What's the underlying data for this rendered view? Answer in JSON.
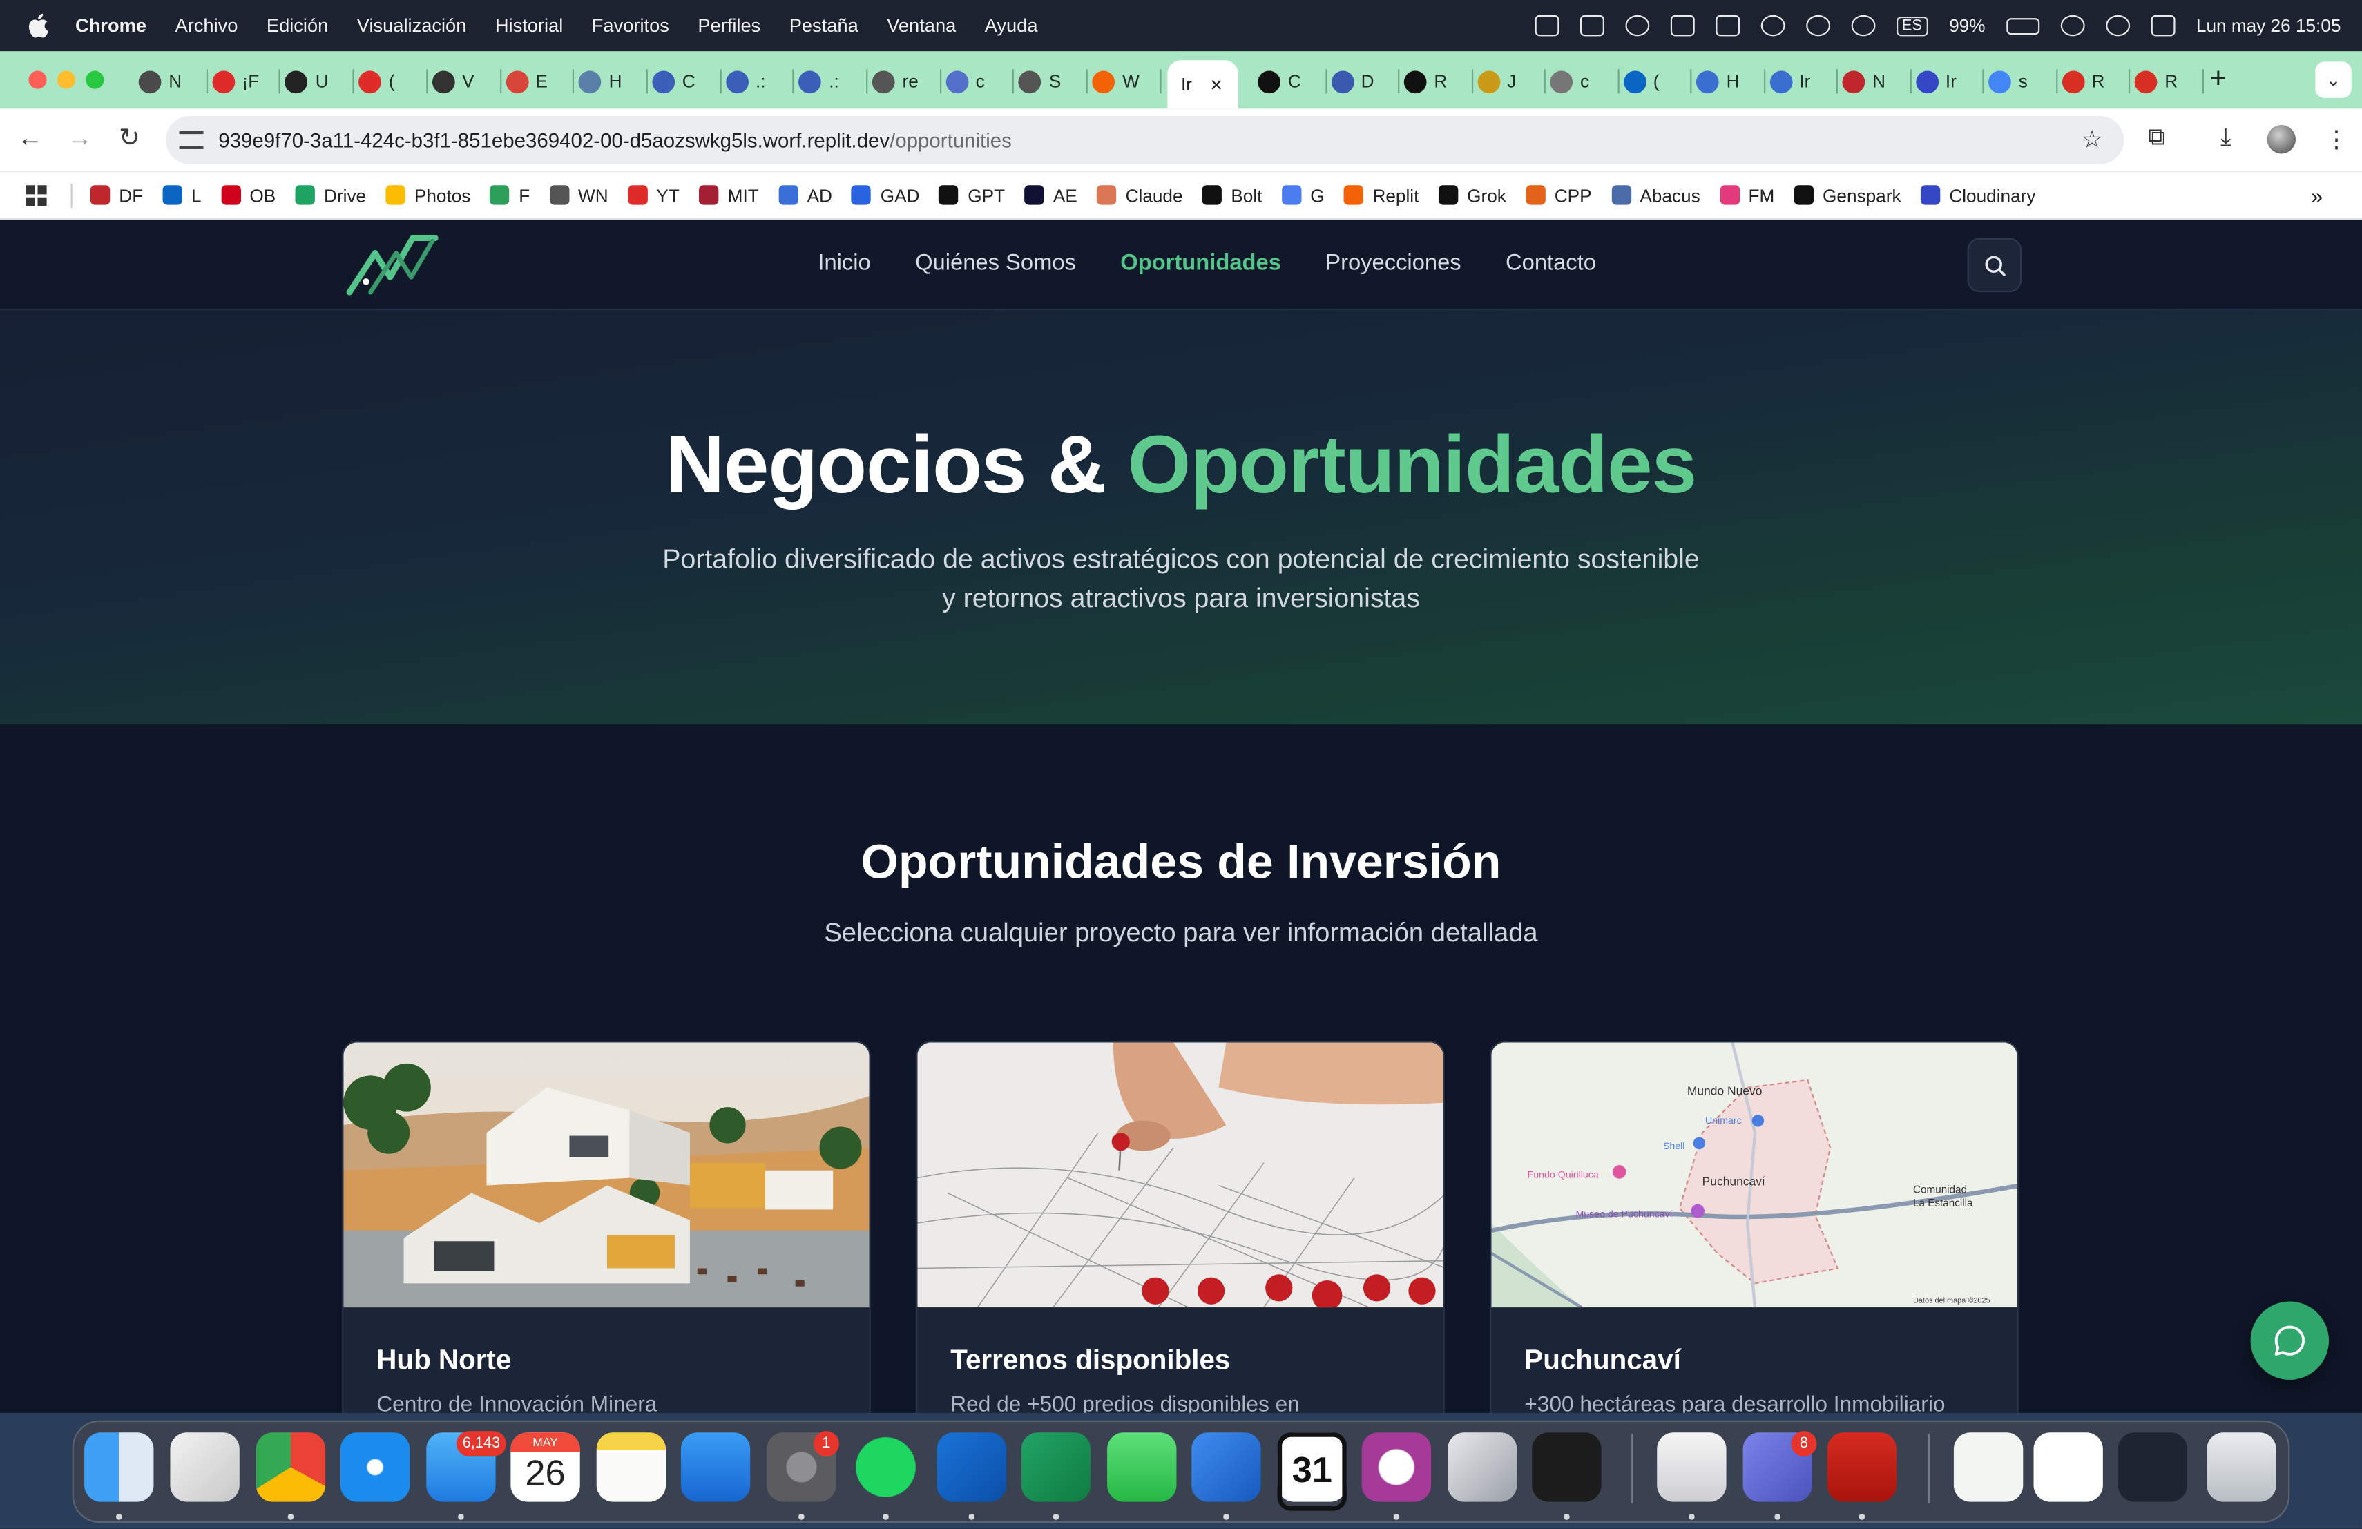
{
  "menubar": {
    "app": "Chrome",
    "items": [
      "Archivo",
      "Edición",
      "Visualización",
      "Historial",
      "Favoritos",
      "Perfiles",
      "Pestaña",
      "Ventana",
      "Ayuda"
    ],
    "input_source": "ES",
    "battery": "99%",
    "datetime": "Lun may 26  15:05"
  },
  "tabs": {
    "items": [
      {
        "letter": "N",
        "icon": "chrome-icon",
        "color": "#4a4a4a"
      },
      {
        "letter": "¡F",
        "icon": "youtube-icon",
        "color": "#e02b2b"
      },
      {
        "letter": "U",
        "icon": "udemy-icon",
        "color": "#222222"
      },
      {
        "letter": "(",
        "icon": "youtube-icon",
        "color": "#e02b2b"
      },
      {
        "letter": "V",
        "icon": "v-icon",
        "color": "#333333"
      },
      {
        "letter": "E",
        "icon": "e-icon",
        "color": "#d8453a"
      },
      {
        "letter": "H",
        "icon": "h-icon",
        "color": "#5a7fa8"
      },
      {
        "letter": "C",
        "icon": "c-icon",
        "color": "#3b5fb8"
      },
      {
        "letter": ".:",
        "icon": "dot-icon",
        "color": "#3b5fb8"
      },
      {
        "letter": ".:",
        "icon": "dot-icon",
        "color": "#3b5fb8"
      },
      {
        "letter": "re",
        "icon": "re-icon",
        "color": "#555555"
      },
      {
        "letter": "c",
        "icon": "c-icon",
        "color": "#5570c8"
      },
      {
        "letter": "S",
        "icon": "s-icon",
        "color": "#555555"
      },
      {
        "letter": "W",
        "icon": "replit-icon",
        "color": "#f26207"
      }
    ],
    "active_label": "Ir",
    "after": [
      {
        "letter": "C",
        "icon": "openai-icon",
        "color": "#111111"
      },
      {
        "letter": "D",
        "icon": "d-icon",
        "color": "#3a5ab0"
      },
      {
        "letter": "R",
        "icon": "github-icon",
        "color": "#111111"
      },
      {
        "letter": "J",
        "icon": "j-icon",
        "color": "#c99a15"
      },
      {
        "letter": "c",
        "icon": "c-icon",
        "color": "#777777"
      },
      {
        "letter": "(",
        "icon": "linkedin-icon",
        "color": "#0a66c2"
      },
      {
        "letter": "H",
        "icon": "h-icon",
        "color": "#3a6fd0"
      },
      {
        "letter": "Ir",
        "icon": "ir-icon",
        "color": "#3a6fd0"
      },
      {
        "letter": "N",
        "icon": "df-icon",
        "color": "#c0272d"
      },
      {
        "letter": "Ir",
        "icon": "cloudinary-icon",
        "color": "#3448c5"
      },
      {
        "letter": "s",
        "icon": "google-icon",
        "color": "#4285f4"
      },
      {
        "letter": "R",
        "icon": "gmail-icon",
        "color": "#d93025"
      },
      {
        "letter": "R",
        "icon": "gmail-icon",
        "color": "#d93025"
      }
    ]
  },
  "address": {
    "host": "939e9f70-3a11-424c-b3f1-851ebe369402-00-d5aozswkg5ls.worf.replit.dev",
    "path": "/opportunities"
  },
  "bookmarks": [
    {
      "label": "DF",
      "color": "#c0272d"
    },
    {
      "label": "L",
      "color": "#0a66c2"
    },
    {
      "label": "OB",
      "color": "#d0021b"
    },
    {
      "label": "Drive",
      "color": "#1ea362"
    },
    {
      "label": "Photos",
      "color": "#fbbc04"
    },
    {
      "label": "F",
      "color": "#2e9e5b"
    },
    {
      "label": "WN",
      "color": "#555555"
    },
    {
      "label": "YT",
      "color": "#e02b2b"
    },
    {
      "label": "MIT",
      "color": "#a31f34"
    },
    {
      "label": "AD",
      "color": "#3b6fd8"
    },
    {
      "label": "GAD",
      "color": "#2a63e0"
    },
    {
      "label": "GPT",
      "color": "#111111"
    },
    {
      "label": "AE",
      "color": "#111133"
    },
    {
      "label": "Claude",
      "color": "#d97757"
    },
    {
      "label": "Bolt",
      "color": "#111111"
    },
    {
      "label": "G",
      "color": "#4a7cf0"
    },
    {
      "label": "Replit",
      "color": "#f26207"
    },
    {
      "label": "Grok",
      "color": "#111111"
    },
    {
      "label": "CPP",
      "color": "#e2641b"
    },
    {
      "label": "Abacus",
      "color": "#4a6aa8"
    },
    {
      "label": "FM",
      "color": "#e23a7a"
    },
    {
      "label": "Genspark",
      "color": "#111111"
    },
    {
      "label": "Cloudinary",
      "color": "#3448c5"
    }
  ],
  "site": {
    "nav": [
      "Inicio",
      "Quiénes Somos",
      "Oportunidades",
      "Proyecciones",
      "Contacto"
    ],
    "active_nav": "Oportunidades",
    "hero": {
      "title_a": "Negocios & ",
      "title_b": "Oportunidades",
      "subtitle_1": "Portafolio diversificado de activos estratégicos con potencial de crecimiento sostenible",
      "subtitle_2": "y retornos atractivos para inversionistas"
    },
    "section": {
      "title": "Oportunidades de Inversión",
      "subtitle": "Selecciona cualquier proyecto para ver información detallada"
    },
    "cards": [
      {
        "title": "Hub Norte",
        "desc": "Centro de Innovación Minera"
      },
      {
        "title": "Terrenos disponibles",
        "desc": "Red de +500 predios disponibles en"
      },
      {
        "title": "Puchuncaví",
        "desc": "+300 hectáreas para desarrollo Inmobiliario"
      }
    ],
    "map_labels": {
      "town1": "Mundo Nuevo",
      "shop": "Unimarc",
      "shell": "Shell",
      "farm": "Fundo Quirilluca",
      "town2": "Puchuncaví",
      "museum": "Museo de Puchuncaví",
      "community": "Comunidad",
      "community2": "La Estancilla",
      "credit": "Datos del mapa ©2025"
    },
    "accent": "#5fc98e"
  },
  "dock": {
    "mail_badge": "6,143",
    "calendar_month": "MAY",
    "calendar_day": "26",
    "settings_badge": "1",
    "teams_badge": "8",
    "fantastical_day": "31"
  }
}
